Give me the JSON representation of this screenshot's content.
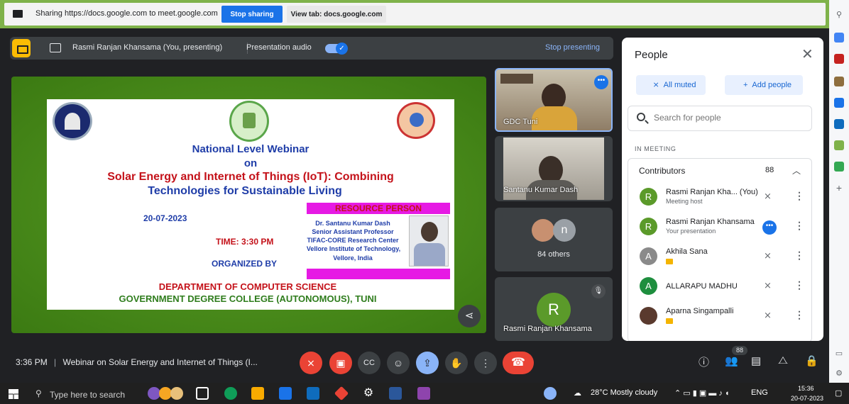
{
  "share_bar": {
    "text": "Sharing https://docs.google.com to meet.google.com",
    "stop_sharing": "Stop sharing",
    "view_tab": "View tab: docs.google.com"
  },
  "presenting_bar": {
    "presenter": "Rasmi Ranjan Khansama (You, presenting)",
    "audio_label": "Presentation audio",
    "audio_on": true,
    "stop_presenting": "Stop presenting"
  },
  "slide": {
    "line1": "National Level Webinar",
    "line2": "on",
    "line3": "Solar Energy and Internet of Things (IoT): Combining",
    "line4": "Technologies for Sustainable Living",
    "date": "20-07-2023",
    "time": "TIME: 3:30 PM",
    "organized": "ORGANIZED BY",
    "resource_person": "RESOURCE PERSON",
    "rp_name": "Dr. Santanu Kumar Dash",
    "rp_title": "Senior Assistant Professor",
    "rp_center": "TIFAC-CORE Research Center",
    "rp_inst": "Vellore Institute of Technology,",
    "rp_place": "Vellore, India",
    "dept": "DEPARTMENT OF COMPUTER SCIENCE",
    "college": "GOVERNMENT DEGREE COLLEGE (AUTONOMOUS), TUNI"
  },
  "tiles": {
    "t1_name": "GDC Tuni",
    "t2_name": "Santanu Kumar Dash",
    "t3_others": "84 others",
    "t3_initial": "n",
    "t4_name": "Rasmi Ranjan Khansama",
    "t4_initial": "R"
  },
  "people": {
    "title": "People",
    "all_muted": "All muted",
    "add_people": "Add people",
    "search_placeholder": "Search for people",
    "in_meeting": "IN MEETING",
    "contributors": "Contributors",
    "count": "88",
    "rows": [
      {
        "initial": "R",
        "name": "Rasmi Ranjan Kha...  (You)",
        "sub": "Meeting host",
        "color": "#5b9a2a"
      },
      {
        "initial": "R",
        "name": "Rasmi Ranjan Khansama",
        "sub": "Your presentation",
        "color": "#5b9a2a"
      },
      {
        "initial": "A",
        "name": "Akhila Sana",
        "sub": "",
        "color": "#8a8a8a"
      },
      {
        "initial": "A",
        "name": "ALLARAPU MADHU",
        "sub": "",
        "color": "#1e8e3e"
      },
      {
        "initial": "",
        "name": "Aparna Singampalli",
        "sub": "",
        "color": "#5a3a2e"
      }
    ]
  },
  "bottom": {
    "clock": "3:36 PM",
    "title": "Webinar on Solar Energy and Internet of Things (I...",
    "people_count": "88"
  },
  "taskbar": {
    "search": "Type here to search",
    "weather": "28°C  Mostly cloudy",
    "lang": "ENG",
    "time": "15:36",
    "date": "20-07-2023"
  },
  "colors": {
    "accent_blue": "#1a73e8",
    "danger_red": "#ea4335",
    "meet_bg": "#202124"
  }
}
